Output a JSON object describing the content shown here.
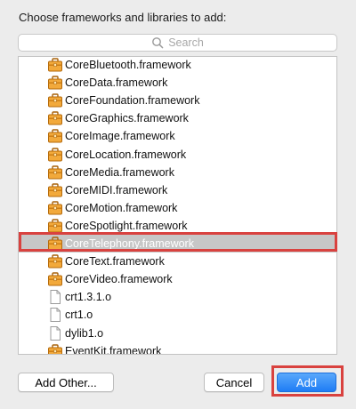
{
  "dialog": {
    "title": "Choose frameworks and libraries to add:"
  },
  "search": {
    "placeholder": "Search"
  },
  "list": {
    "items": [
      {
        "label": "CoreBluetooth.framework",
        "icon": "toolbox-icon",
        "selected": false
      },
      {
        "label": "CoreData.framework",
        "icon": "toolbox-icon",
        "selected": false
      },
      {
        "label": "CoreFoundation.framework",
        "icon": "toolbox-icon",
        "selected": false
      },
      {
        "label": "CoreGraphics.framework",
        "icon": "toolbox-icon",
        "selected": false
      },
      {
        "label": "CoreImage.framework",
        "icon": "toolbox-icon",
        "selected": false
      },
      {
        "label": "CoreLocation.framework",
        "icon": "toolbox-icon",
        "selected": false
      },
      {
        "label": "CoreMedia.framework",
        "icon": "toolbox-icon",
        "selected": false
      },
      {
        "label": "CoreMIDI.framework",
        "icon": "toolbox-icon",
        "selected": false
      },
      {
        "label": "CoreMotion.framework",
        "icon": "toolbox-icon",
        "selected": false
      },
      {
        "label": "CoreSpotlight.framework",
        "icon": "toolbox-icon",
        "selected": false
      },
      {
        "label": "CoreTelephony.framework",
        "icon": "toolbox-icon",
        "selected": true
      },
      {
        "label": "CoreText.framework",
        "icon": "toolbox-icon",
        "selected": false
      },
      {
        "label": "CoreVideo.framework",
        "icon": "toolbox-icon",
        "selected": false
      },
      {
        "label": "crt1.3.1.o",
        "icon": "document-icon",
        "selected": false
      },
      {
        "label": "crt1.o",
        "icon": "document-icon",
        "selected": false
      },
      {
        "label": "dylib1.o",
        "icon": "document-icon",
        "selected": false
      },
      {
        "label": "EventKit.framework",
        "icon": "toolbox-icon",
        "selected": false
      }
    ]
  },
  "buttons": {
    "add_other": "Add Other...",
    "cancel": "Cancel",
    "add": "Add"
  },
  "colors": {
    "highlight": "#d9423f",
    "selection": "#c7c7c7",
    "primary": "#1f7df5"
  }
}
